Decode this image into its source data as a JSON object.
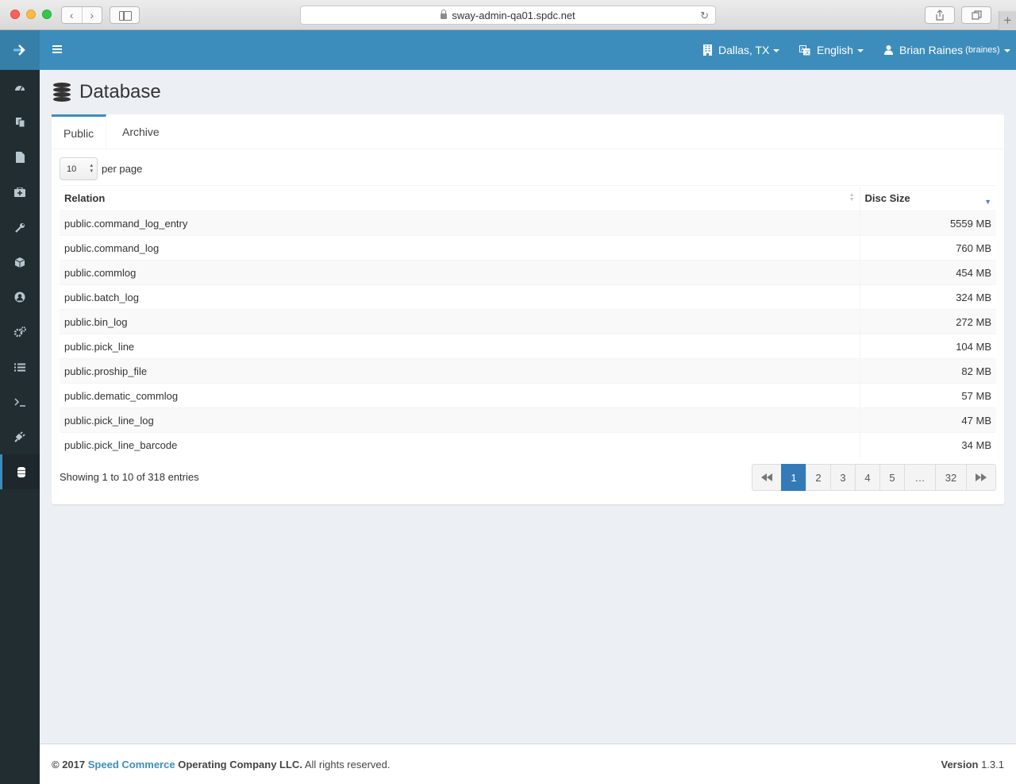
{
  "browser": {
    "url": "sway-admin-qa01.spdc.net"
  },
  "header": {
    "location": "Dallas, TX",
    "language": "English",
    "user_name": "Brian Raines",
    "user_handle": "(braines)"
  },
  "sidebar": {
    "items": [
      {
        "icon": "dashboard-icon"
      },
      {
        "icon": "copy-icon"
      },
      {
        "icon": "file-icon"
      },
      {
        "icon": "medkit-icon"
      },
      {
        "icon": "wrench-icon"
      },
      {
        "icon": "cube-icon"
      },
      {
        "icon": "user-circle-icon"
      },
      {
        "icon": "cogs-icon"
      },
      {
        "icon": "list-icon"
      },
      {
        "icon": "terminal-icon"
      },
      {
        "icon": "plug-icon"
      },
      {
        "icon": "database-icon",
        "active": true
      }
    ]
  },
  "page": {
    "title": "Database"
  },
  "tabs": [
    {
      "label": "Public",
      "active": true
    },
    {
      "label": "Archive",
      "active": false
    }
  ],
  "table": {
    "per_page_value": "10",
    "per_page_label": "per page",
    "columns": [
      "Relation",
      "Disc Size"
    ],
    "rows": [
      {
        "relation": "public.command_log_entry",
        "size": "5559 MB"
      },
      {
        "relation": "public.command_log",
        "size": "760 MB"
      },
      {
        "relation": "public.commlog",
        "size": "454 MB"
      },
      {
        "relation": "public.batch_log",
        "size": "324 MB"
      },
      {
        "relation": "public.bin_log",
        "size": "272 MB"
      },
      {
        "relation": "public.pick_line",
        "size": "104 MB"
      },
      {
        "relation": "public.proship_file",
        "size": "82 MB"
      },
      {
        "relation": "public.dematic_commlog",
        "size": "57 MB"
      },
      {
        "relation": "public.pick_line_log",
        "size": "47 MB"
      },
      {
        "relation": "public.pick_line_barcode",
        "size": "34 MB"
      }
    ],
    "info": "Showing 1 to 10 of 318 entries",
    "pages": [
      "1",
      "2",
      "3",
      "4",
      "5",
      "…",
      "32"
    ]
  },
  "footer": {
    "copyright_prefix": "© 2017",
    "company_link": "Speed Commerce",
    "company_rest": "Operating Company LLC.",
    "rights": "All rights reserved.",
    "version_label": "Version",
    "version_value": "1.3.1"
  },
  "colors": {
    "header": "#3c8dbc",
    "brand": "#367fa9",
    "sidebar": "#222d32",
    "active_page": "#337ab7"
  }
}
